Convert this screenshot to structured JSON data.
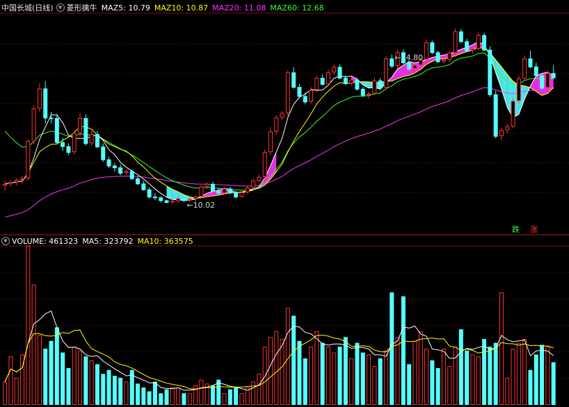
{
  "price_header": {
    "stock_name": "中国长城(日线)",
    "indicator_name": "菱形擒牛",
    "items": [
      {
        "label": "MAZ5:",
        "value": "10.79",
        "color": "#ffffff"
      },
      {
        "label": "MAZ10:",
        "value": "10.87",
        "color": "#ffff00"
      },
      {
        "label": "MAZ20:",
        "value": "11.08",
        "color": "#ff33ff"
      },
      {
        "label": "MAZ60:",
        "value": "12.68",
        "color": "#33ff33"
      }
    ]
  },
  "volume_header": {
    "items": [
      {
        "label": "VOLUME:",
        "value": "461323",
        "color": "#ffffff"
      },
      {
        "label": "MA5:",
        "value": "323792",
        "color": "#ffffff"
      },
      {
        "label": "MA10:",
        "value": "363575",
        "color": "#ffff00"
      }
    ]
  },
  "legend": {
    "down": "跌",
    "up": "涨",
    "down_color": "#33ff33",
    "up_color": "#ff3333"
  },
  "colors": {
    "up": "#ff3333",
    "down": "#54ffff",
    "ma5": "#ffffff",
    "ma10": "#ffff00",
    "ma20": "#ff33ff",
    "ma60": "#33ff33",
    "grid": "#7a1010"
  },
  "chart_data": [
    {
      "type": "candlestick",
      "annotations": [
        {
          "text": "14.80",
          "index": 67
        },
        {
          "text": "10.02",
          "index": 31
        }
      ],
      "ylim": [
        9.5,
        15.2
      ],
      "series_names": [
        "MAZ5",
        "MAZ10",
        "MAZ20",
        "MAZ60"
      ],
      "ohlc": [
        [
          10.5,
          10.64,
          10.35,
          10.55
        ],
        [
          10.55,
          10.65,
          10.48,
          10.6
        ],
        [
          10.6,
          10.71,
          10.51,
          10.66
        ],
        [
          10.66,
          10.77,
          10.55,
          10.7
        ],
        [
          10.7,
          11.78,
          10.64,
          11.72
        ],
        [
          11.72,
          12.69,
          11.63,
          12.61
        ],
        [
          12.61,
          13.3,
          12.53,
          13.16
        ],
        [
          13.16,
          13.36,
          12.2,
          12.36
        ],
        [
          12.36,
          12.52,
          12.2,
          12.35
        ],
        [
          12.35,
          12.46,
          11.65,
          11.69
        ],
        [
          11.69,
          11.81,
          11.45,
          11.58
        ],
        [
          11.58,
          11.66,
          11.34,
          11.42
        ],
        [
          11.42,
          12.0,
          11.36,
          11.94
        ],
        [
          11.94,
          12.49,
          11.84,
          12.35
        ],
        [
          12.35,
          12.45,
          11.6,
          11.66
        ],
        [
          11.66,
          12.01,
          11.6,
          11.91
        ],
        [
          11.91,
          12.0,
          11.53,
          11.57
        ],
        [
          11.57,
          11.66,
          11.15,
          11.22
        ],
        [
          11.22,
          11.29,
          10.98,
          11.05
        ],
        [
          11.05,
          11.12,
          10.88,
          11.0
        ],
        [
          11.0,
          11.08,
          10.78,
          10.85
        ],
        [
          10.85,
          10.94,
          10.8,
          10.9
        ],
        [
          10.9,
          10.95,
          10.66,
          10.7
        ],
        [
          10.7,
          10.76,
          10.52,
          10.56
        ],
        [
          10.56,
          10.64,
          10.36,
          10.4
        ],
        [
          10.4,
          10.46,
          10.15,
          10.2
        ],
        [
          10.2,
          10.3,
          10.1,
          10.18
        ],
        [
          10.18,
          10.21,
          10.04,
          10.1
        ],
        [
          10.1,
          10.12,
          10.02,
          10.05
        ],
        [
          10.05,
          10.14,
          10.0,
          10.08
        ],
        [
          10.08,
          10.19,
          10.02,
          10.15
        ],
        [
          10.15,
          10.19,
          10.05,
          10.1
        ],
        [
          10.1,
          10.18,
          10.05,
          10.14
        ],
        [
          10.14,
          10.23,
          10.06,
          10.2
        ],
        [
          10.2,
          10.51,
          10.18,
          10.48
        ],
        [
          10.48,
          10.59,
          10.4,
          10.55
        ],
        [
          10.55,
          10.61,
          10.33,
          10.36
        ],
        [
          10.36,
          10.43,
          10.26,
          10.3
        ],
        [
          10.3,
          10.46,
          10.27,
          10.42
        ],
        [
          10.42,
          10.47,
          10.27,
          10.31
        ],
        [
          10.31,
          10.35,
          10.15,
          10.2
        ],
        [
          10.2,
          10.35,
          10.17,
          10.32
        ],
        [
          10.32,
          10.51,
          10.28,
          10.45
        ],
        [
          10.45,
          10.69,
          10.38,
          10.64
        ],
        [
          10.64,
          10.8,
          10.57,
          10.74
        ],
        [
          10.74,
          11.49,
          10.69,
          11.42
        ],
        [
          11.42,
          12.1,
          11.33,
          11.98
        ],
        [
          11.98,
          12.43,
          11.9,
          12.36
        ],
        [
          12.36,
          12.54,
          12.3,
          12.49
        ],
        [
          12.49,
          13.66,
          12.41,
          13.6
        ],
        [
          13.6,
          13.74,
          13.16,
          13.2
        ],
        [
          13.2,
          13.28,
          12.9,
          12.95
        ],
        [
          12.95,
          13.05,
          12.73,
          12.8
        ],
        [
          12.8,
          13.2,
          12.75,
          13.12
        ],
        [
          13.12,
          13.51,
          13.06,
          13.45
        ],
        [
          13.45,
          13.54,
          13.24,
          13.28
        ],
        [
          13.28,
          13.68,
          13.22,
          13.6
        ],
        [
          13.6,
          13.82,
          13.52,
          13.75
        ],
        [
          13.75,
          13.82,
          13.41,
          13.45
        ],
        [
          13.45,
          13.52,
          13.25,
          13.3
        ],
        [
          13.3,
          13.48,
          13.24,
          13.4
        ],
        [
          13.4,
          13.46,
          13.1,
          13.15
        ],
        [
          13.15,
          13.2,
          12.92,
          12.98
        ],
        [
          12.98,
          13.08,
          12.88,
          13.02
        ],
        [
          13.02,
          13.45,
          12.98,
          13.38
        ],
        [
          13.38,
          13.45,
          13.12,
          13.18
        ],
        [
          13.18,
          14.04,
          13.12,
          13.98
        ],
        [
          13.98,
          14.09,
          13.72,
          13.78
        ],
        [
          13.78,
          14.22,
          13.7,
          14.15
        ],
        [
          14.15,
          14.22,
          13.82,
          13.87
        ],
        [
          13.87,
          13.92,
          13.64,
          13.7
        ],
        [
          13.7,
          13.85,
          13.55,
          13.8
        ],
        [
          13.8,
          14.0,
          13.72,
          13.95
        ],
        [
          13.95,
          14.5,
          13.85,
          14.42
        ],
        [
          14.42,
          14.47,
          14.1,
          14.15
        ],
        [
          14.15,
          14.2,
          13.86,
          13.9
        ],
        [
          13.9,
          14.0,
          13.84,
          13.95
        ],
        [
          13.95,
          14.2,
          13.88,
          14.13
        ],
        [
          14.13,
          14.8,
          14.02,
          14.72
        ],
        [
          14.72,
          14.79,
          14.4,
          14.45
        ],
        [
          14.45,
          14.52,
          14.15,
          14.2
        ],
        [
          14.2,
          14.29,
          14.12,
          14.25
        ],
        [
          14.25,
          14.7,
          14.2,
          14.62
        ],
        [
          14.62,
          14.68,
          14.18,
          14.22
        ],
        [
          14.22,
          14.31,
          12.93,
          13.0
        ],
        [
          13.0,
          13.1,
          11.8,
          11.86
        ],
        [
          11.86,
          12.09,
          11.73,
          12.02
        ],
        [
          12.02,
          12.19,
          11.94,
          12.12
        ],
        [
          12.12,
          12.89,
          12.07,
          12.82
        ],
        [
          12.82,
          13.51,
          12.75,
          13.43
        ],
        [
          13.43,
          14.06,
          13.37,
          13.98
        ],
        [
          13.98,
          14.2,
          13.71,
          13.76
        ],
        [
          13.76,
          13.86,
          13.46,
          13.52
        ],
        [
          13.52,
          13.58,
          13.13,
          13.18
        ],
        [
          13.18,
          13.65,
          13.13,
          13.58
        ],
        [
          13.58,
          13.8,
          13.42,
          13.46
        ]
      ],
      "volume_ylim": [
        0,
        820000
      ],
      "volume": [
        120000,
        250000,
        140000,
        260000,
        820000,
        620000,
        360000,
        290000,
        330000,
        400000,
        270000,
        190000,
        300000,
        280000,
        250000,
        230000,
        210000,
        160000,
        180000,
        150000,
        140000,
        120000,
        180000,
        110000,
        90000,
        70000,
        120000,
        60000,
        80000,
        90000,
        90000,
        60000,
        60000,
        100000,
        130000,
        110000,
        100000,
        130000,
        60000,
        80000,
        90000,
        60000,
        90000,
        120000,
        160000,
        300000,
        350000,
        380000,
        340000,
        500000,
        460000,
        330000,
        240000,
        300000,
        380000,
        320000,
        300000,
        270000,
        300000,
        350000,
        240000,
        320000,
        270000,
        260000,
        200000,
        240000,
        280000,
        580000,
        350000,
        560000,
        210000,
        330000,
        380000,
        290000,
        230000,
        190000,
        290000,
        200000,
        300000,
        390000,
        280000,
        260000,
        250000,
        340000,
        300000,
        320000,
        580000,
        140000,
        290000,
        320000,
        340000,
        180000,
        260000,
        310000,
        300000,
        220000
      ]
    }
  ]
}
